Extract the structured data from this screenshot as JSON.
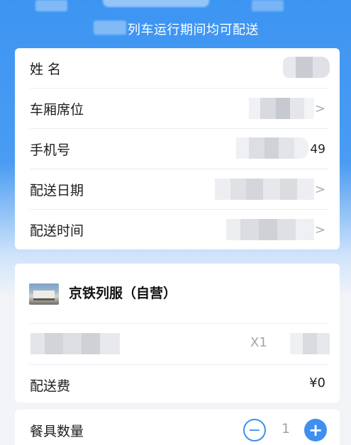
{
  "header": {
    "subtitle": "列车运行期间均可配送"
  },
  "form": {
    "rows": [
      {
        "label": "姓  名",
        "tail": "",
        "chevron": false
      },
      {
        "label": "车厢席位",
        "tail": "",
        "chevron": true
      },
      {
        "label": "手机号",
        "tail": "49",
        "chevron": false
      },
      {
        "label": "配送日期",
        "tail": "",
        "chevron": true
      },
      {
        "label": "配送时间",
        "tail": "",
        "chevron": true
      }
    ],
    "chevron_glyph": ">"
  },
  "shop": {
    "name": "京铁列服（自营）",
    "item_qty": "X1",
    "delivery_fee_label": "配送费",
    "delivery_fee_value": "¥0"
  },
  "tableware": {
    "label": "餐具数量",
    "count": "1",
    "minus_glyph": "−",
    "plus_glyph": "+"
  },
  "colors": {
    "accent": "#3e8ff0",
    "header_blue": "#3d95f2"
  }
}
